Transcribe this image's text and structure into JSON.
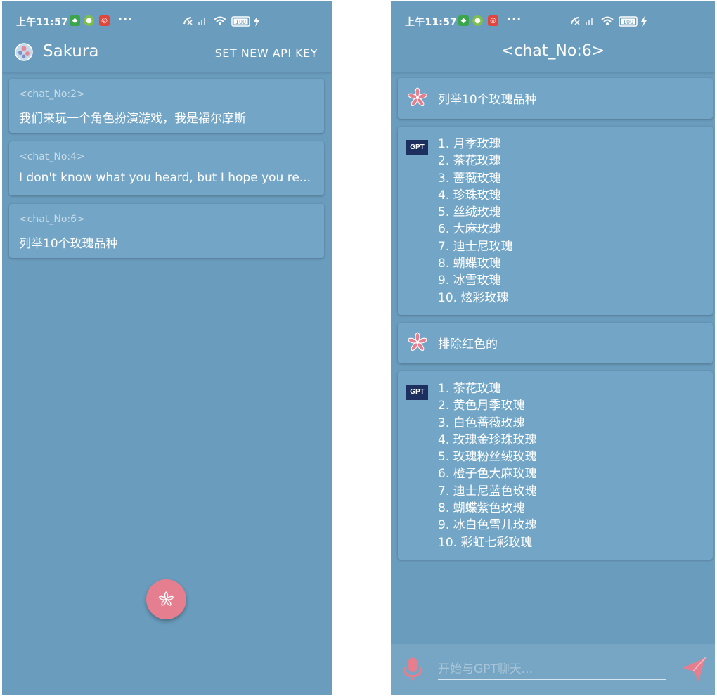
{
  "colors": {
    "background": "#6a9cbd",
    "card": "#73a6c6",
    "accent_pink": "#e57f8f",
    "gpt_badge": "#1c2f5e",
    "hint": "#c8dbe7"
  },
  "status_bar": {
    "time": "上午11:57",
    "battery": "100",
    "more": "···"
  },
  "left": {
    "app_title": "Sakura",
    "app_icon": "sakura-logo-icon",
    "action": "SET NEW API KEY",
    "chats": [
      {
        "tag": "<chat_No:2>",
        "preview": "我们来玩一个角色扮演游戏，我是福尔摩斯"
      },
      {
        "tag": "<chat_No:4>",
        "preview": "I don't know what you heard, but I hope you re..."
      },
      {
        "tag": "<chat_No:6>",
        "preview": "列举10个玫瑰品种"
      }
    ],
    "fab_icon": "sakura-flower-icon"
  },
  "right": {
    "title": "<chat_No:6>",
    "messages": [
      {
        "role": "user",
        "text": "列举10个玫瑰品种"
      },
      {
        "role": "assistant",
        "badge": "GPT",
        "items": [
          "1. 月季玫瑰",
          "2. 茶花玫瑰",
          "3. 蔷薇玫瑰",
          "4. 珍珠玫瑰",
          "5. 丝绒玫瑰",
          "6. 大麻玫瑰",
          "7. 迪士尼玫瑰",
          "8. 蝴蝶玫瑰",
          "9. 冰雪玫瑰",
          "10. 炫彩玫瑰"
        ]
      },
      {
        "role": "user",
        "text": "排除红色的"
      },
      {
        "role": "assistant",
        "badge": "GPT",
        "items": [
          "1. 茶花玫瑰",
          "2. 黄色月季玫瑰",
          "3. 白色蔷薇玫瑰",
          "4. 玫瑰金珍珠玫瑰",
          "5. 玫瑰粉丝绒玫瑰",
          "6. 橙子色大麻玫瑰",
          "7. 迪士尼蓝色玫瑰",
          "8. 蝴蝶紫色玫瑰",
          "9. 冰白色雪儿玫瑰",
          "10. 彩虹七彩玫瑰"
        ]
      }
    ],
    "input": {
      "placeholder": "开始与GPT聊天..."
    },
    "icons": {
      "mic": "microphone-icon",
      "send": "send-icon",
      "user_avatar": "sakura-flower-icon"
    }
  }
}
